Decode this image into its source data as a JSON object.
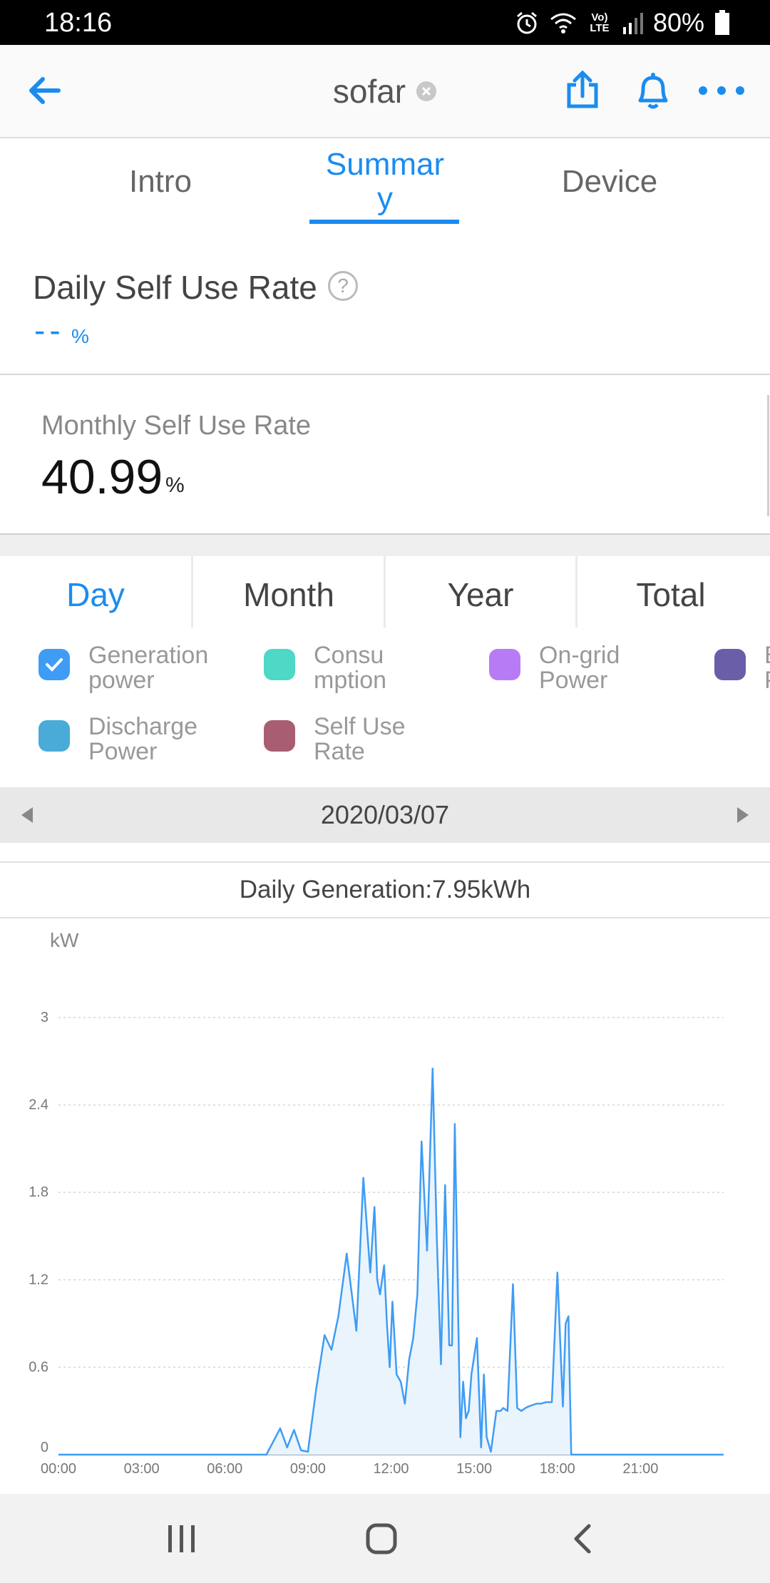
{
  "status_bar": {
    "time": "18:16",
    "battery": "80%",
    "icons": [
      "alarm-icon",
      "wifi-icon",
      "volte-icon",
      "signal-icon",
      "battery-icon"
    ],
    "volte_text": "Vo) LTE"
  },
  "header": {
    "title": "sofar",
    "icons": [
      "back-arrow-icon",
      "clear-icon",
      "share-icon",
      "bell-icon",
      "more-icon"
    ],
    "accent": "#1a8cf0"
  },
  "tabs": [
    {
      "label": "Intro",
      "active": false
    },
    {
      "label": "Summar\ny",
      "active": true
    },
    {
      "label": "Device",
      "active": false
    }
  ],
  "daily_self_use": {
    "label": "Daily Self Use Rate",
    "help": "?",
    "value": "--",
    "unit": "%"
  },
  "monthly_self_use": {
    "label": "Monthly Self Use Rate",
    "value": "40.99",
    "unit": "%"
  },
  "period_tabs": [
    {
      "label": "Day",
      "active": true
    },
    {
      "label": "Month",
      "active": false
    },
    {
      "label": "Year",
      "active": false
    },
    {
      "label": "Total",
      "active": false
    }
  ],
  "legend": [
    {
      "label": "Generation\npower",
      "color": "#3f9cf4",
      "checked": true
    },
    {
      "label": "Consu\nmption",
      "color": "#4ed8c6",
      "checked": false
    },
    {
      "label": "On-grid\nPower",
      "color": "#b77cf5",
      "checked": false
    },
    {
      "label": "B\nP",
      "color": "#6a5ea8",
      "checked": false
    },
    {
      "label": "Discharge\nPower",
      "color": "#4aabd9",
      "checked": false
    },
    {
      "label": "Self Use\nRate",
      "color": "#a85d73",
      "checked": false
    }
  ],
  "date_bar": {
    "date": "2020/03/07",
    "icons": [
      "prev-date-icon",
      "next-date-icon"
    ]
  },
  "daily_generation": "Daily Generation:7.95kWh",
  "chart_data": {
    "type": "area",
    "ylabel": "kW",
    "ylim": [
      0,
      3
    ],
    "yticks": [
      "0",
      "0.6",
      "1.2",
      "1.8",
      "2.4",
      "3"
    ],
    "xticks": [
      "00:00",
      "03:00",
      "06:00",
      "09:00",
      "12:00",
      "15:00",
      "18:00",
      "21:00"
    ],
    "xlim_hours": [
      0,
      24
    ],
    "grid": true,
    "series": [
      {
        "color": "#3f9cf4",
        "fill": "#eaf4fd",
        "x": [
          0,
          7.5,
          8.0,
          8.25,
          8.5,
          8.75,
          9.0,
          9.3,
          9.6,
          9.85,
          10.1,
          10.4,
          10.75,
          11.0,
          11.25,
          11.4,
          11.5,
          11.6,
          11.75,
          11.85,
          11.95,
          12.05,
          12.2,
          12.35,
          12.5,
          12.65,
          12.8,
          12.95,
          13.1,
          13.3,
          13.5,
          13.65,
          13.8,
          13.95,
          14.1,
          14.2,
          14.3,
          14.5,
          14.6,
          14.7,
          14.8,
          14.9,
          15.1,
          15.25,
          15.35,
          15.45,
          15.6,
          15.8,
          15.95,
          16.05,
          16.2,
          16.4,
          16.55,
          16.7,
          16.85,
          16.95,
          17.1,
          17.25,
          17.4,
          17.6,
          17.8,
          18.0,
          18.2,
          18.3,
          18.4,
          18.5,
          18.6,
          18.7,
          18.8,
          24
        ],
        "y": [
          0,
          0,
          0.18,
          0.05,
          0.17,
          0.03,
          0.02,
          0.45,
          0.82,
          0.72,
          0.95,
          1.38,
          0.85,
          1.9,
          1.25,
          1.7,
          1.2,
          1.1,
          1.3,
          0.9,
          0.6,
          1.05,
          0.55,
          0.5,
          0.35,
          0.65,
          0.8,
          1.1,
          2.15,
          1.4,
          2.65,
          1.5,
          0.62,
          1.85,
          0.75,
          0.75,
          2.27,
          0.12,
          0.5,
          0.25,
          0.3,
          0.55,
          0.8,
          0.05,
          0.55,
          0.12,
          0.02,
          0.3,
          0.3,
          0.32,
          0.3,
          1.17,
          0.32,
          0.3,
          0.32,
          0.33,
          0.34,
          0.35,
          0.35,
          0.36,
          0.36,
          1.25,
          0.33,
          0.9,
          0.95,
          0,
          0,
          0,
          0,
          0
        ]
      }
    ]
  }
}
